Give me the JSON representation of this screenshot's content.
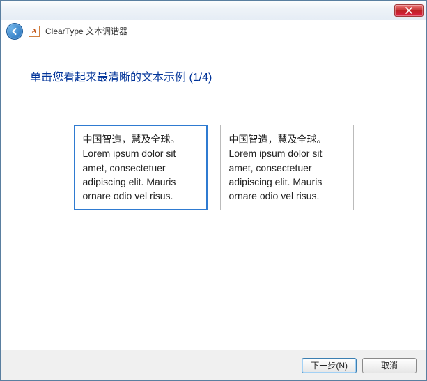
{
  "window": {
    "app_icon_letter": "A",
    "title": "ClearType 文本调谐器"
  },
  "heading": "单击您看起来最清晰的文本示例 (1/4)",
  "samples": [
    {
      "text": "中国智造，慧及全球。 Lorem ipsum dolor sit amet, consectetuer adipiscing elit. Mauris ornare odio vel risus.",
      "selected": true
    },
    {
      "text": "中国智造，慧及全球。 Lorem ipsum dolor sit amet, consectetuer adipiscing elit. Mauris ornare odio vel risus.",
      "selected": false
    }
  ],
  "footer": {
    "next_label": "下一步(N)",
    "cancel_label": "取消"
  },
  "colors": {
    "heading": "#003399",
    "selection_border": "#2f7bd1"
  }
}
